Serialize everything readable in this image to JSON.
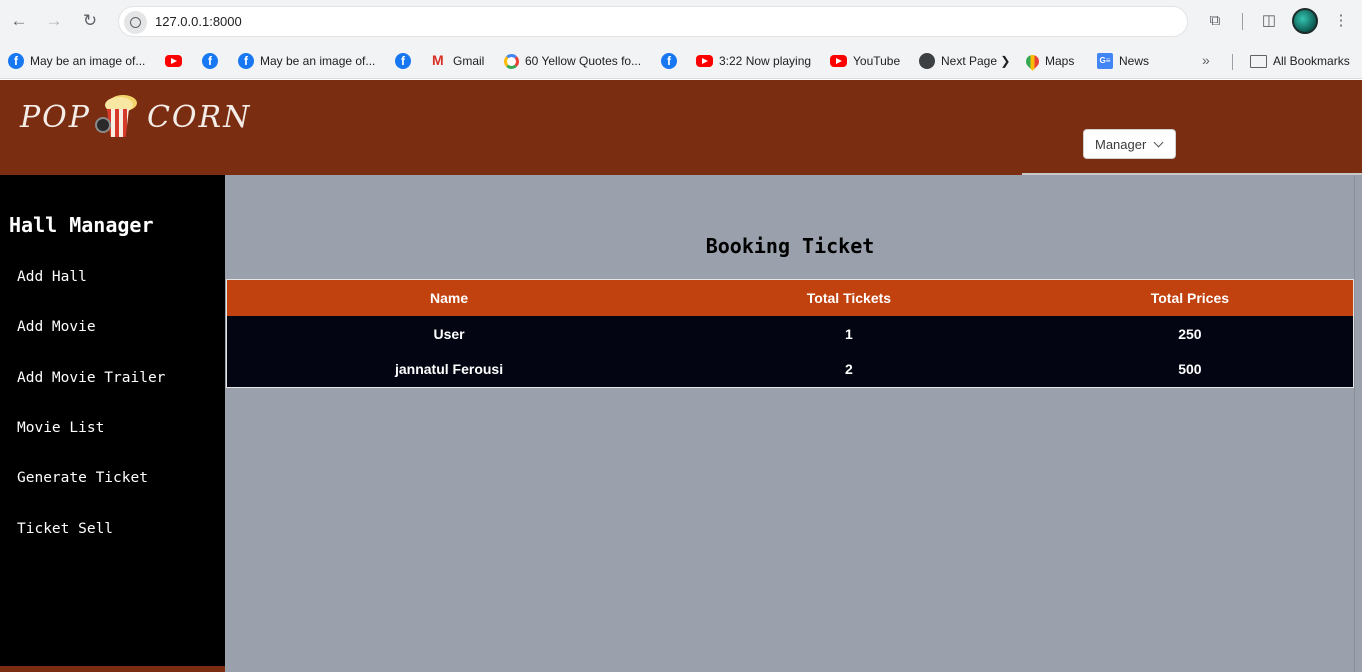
{
  "browser": {
    "url": "127.0.0.1:8000",
    "bookmarks": [
      {
        "icon": "facebook-icon",
        "label": "May be an image of..."
      },
      {
        "icon": "youtube-icon",
        "label": ""
      },
      {
        "icon": "facebook-icon",
        "label": ""
      },
      {
        "icon": "facebook-icon",
        "label": "May be an image of..."
      },
      {
        "icon": "facebook-icon",
        "label": ""
      },
      {
        "icon": "gmail-icon",
        "label": "Gmail"
      },
      {
        "icon": "google-icon",
        "label": "60 Yellow Quotes fo..."
      },
      {
        "icon": "facebook-icon",
        "label": ""
      },
      {
        "icon": "youtube-icon",
        "label": "3:22 Now playing"
      },
      {
        "icon": "youtube-icon",
        "label": "YouTube"
      },
      {
        "icon": "globe-icon",
        "label": "Next Page ❯"
      },
      {
        "icon": "maps-icon",
        "label": "Maps"
      },
      {
        "icon": "news-icon",
        "label": "News"
      }
    ],
    "all_bookmarks": "All Bookmarks"
  },
  "header": {
    "logo_left": "POP",
    "logo_right": "CORN",
    "user_menu": "Manager"
  },
  "sidebar": {
    "title": "Hall Manager",
    "items": [
      {
        "label": "Add Hall"
      },
      {
        "label": "Add Movie"
      },
      {
        "label": "Add Movie Trailer"
      },
      {
        "label": "Movie List"
      },
      {
        "label": "Generate Ticket"
      },
      {
        "label": "Ticket Sell"
      }
    ]
  },
  "main": {
    "title": "Booking Ticket",
    "table": {
      "columns": [
        "Name",
        "Total Tickets",
        "Total Prices"
      ],
      "rows": [
        [
          "User",
          "1",
          "250"
        ],
        [
          "jannatul Ferousi",
          "2",
          "500"
        ]
      ]
    }
  },
  "colors": {
    "header_bg": "#7b2d12",
    "table_header_bg": "#c1410f",
    "table_row_bg": "#030612",
    "main_bg": "#9aa1ac",
    "sidebar_bg": "#000000"
  }
}
